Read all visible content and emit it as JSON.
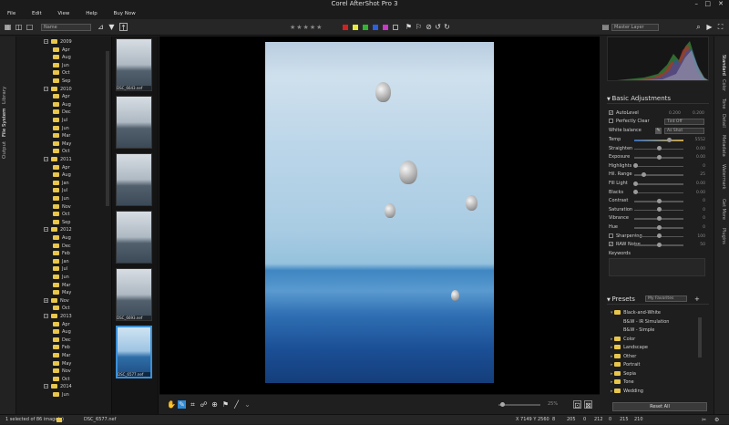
{
  "title": "Corel AfterShot Pro 3",
  "menu": [
    "File",
    "Edit",
    "View",
    "Help",
    "Buy Now"
  ],
  "left_tabs": [
    "Library",
    "File System",
    "Output"
  ],
  "toolbar": {
    "sort_select": "Name",
    "stars": "★★★★★",
    "color_labels": [
      "#d32020",
      "#e8e83a",
      "#2fb52f",
      "#2c5fe0",
      "#c938c9"
    ],
    "layer_select": "Master Layer"
  },
  "tree": [
    {
      "label": "2009",
      "level": 0,
      "expand": "−"
    },
    {
      "label": "Apr",
      "level": 1
    },
    {
      "label": "Aug",
      "level": 1
    },
    {
      "label": "Jun",
      "level": 1
    },
    {
      "label": "Oct",
      "level": 1
    },
    {
      "label": "Sep",
      "level": 1
    },
    {
      "label": "2010",
      "level": 0,
      "expand": "−"
    },
    {
      "label": "Apr",
      "level": 1
    },
    {
      "label": "Aug",
      "level": 1
    },
    {
      "label": "Dec",
      "level": 1
    },
    {
      "label": "Jul",
      "level": 1
    },
    {
      "label": "Jun",
      "level": 1
    },
    {
      "label": "Mar",
      "level": 1
    },
    {
      "label": "May",
      "level": 1
    },
    {
      "label": "Oct",
      "level": 1
    },
    {
      "label": "2011",
      "level": 0,
      "expand": "−"
    },
    {
      "label": "Apr",
      "level": 1
    },
    {
      "label": "Aug",
      "level": 1
    },
    {
      "label": "Jan",
      "level": 1
    },
    {
      "label": "Jul",
      "level": 1
    },
    {
      "label": "Jun",
      "level": 1
    },
    {
      "label": "Nov",
      "level": 1
    },
    {
      "label": "Oct",
      "level": 1
    },
    {
      "label": "Sep",
      "level": 1
    },
    {
      "label": "2012",
      "level": 0,
      "expand": "−"
    },
    {
      "label": "Aug",
      "level": 1
    },
    {
      "label": "Dec",
      "level": 1
    },
    {
      "label": "Feb",
      "level": 1
    },
    {
      "label": "Jan",
      "level": 1
    },
    {
      "label": "Jul",
      "level": 1
    },
    {
      "label": "Jun",
      "level": 1
    },
    {
      "label": "Mar",
      "level": 1
    },
    {
      "label": "May",
      "level": 1
    },
    {
      "label": "Nov",
      "level": 1,
      "expand": "+"
    },
    {
      "label": "Oct",
      "level": 1
    },
    {
      "label": "2013",
      "level": 0,
      "expand": "−"
    },
    {
      "label": "Apr",
      "level": 1
    },
    {
      "label": "Aug",
      "level": 1
    },
    {
      "label": "Dec",
      "level": 1
    },
    {
      "label": "Feb",
      "level": 1
    },
    {
      "label": "Mar",
      "level": 1
    },
    {
      "label": "May",
      "level": 1
    },
    {
      "label": "Nov",
      "level": 1
    },
    {
      "label": "Oct",
      "level": 1
    },
    {
      "label": "2014",
      "level": 0,
      "expand": "−"
    },
    {
      "label": "Jun",
      "level": 1
    }
  ],
  "filmstrip": [
    {
      "label": "DSC_6643.nef",
      "selected": false
    },
    {
      "label": "",
      "selected": false
    },
    {
      "label": "",
      "selected": false
    },
    {
      "label": "",
      "selected": false
    },
    {
      "label": "DSC_6693.nef",
      "selected": false
    },
    {
      "label": "DSC_6577.nef",
      "selected": true
    }
  ],
  "zoom": "25%",
  "status": {
    "selection": "1 selected of 86 image(s)",
    "filename": "DSC_6577.nef",
    "dims": "X 7149 Y 2560",
    "values": [
      "8",
      "205",
      "0",
      "212",
      "0",
      "215",
      "210"
    ]
  },
  "right_tabs": [
    "Standard",
    "Color",
    "Tone",
    "Detail",
    "Metadata",
    "Watermark",
    "Get More",
    "Plugins"
  ],
  "basic_adjustments": {
    "title": "Basic Adjustments",
    "autolevel": {
      "label": "AutoLevel",
      "v1": "0.200",
      "v2": "0.200",
      "checked": true
    },
    "perfectly_clear": {
      "label": "Perfectly Clear",
      "select": "Tint Off",
      "checked": false
    },
    "white_balance": {
      "label": "White balance",
      "select": "As Shot"
    },
    "sliders": [
      {
        "label": "Temp",
        "val": "5552",
        "pos": 0.72,
        "warm": true
      },
      {
        "label": "Straighten",
        "val": "0.00",
        "pos": 0.5
      },
      {
        "label": "Exposure",
        "val": "0.00",
        "pos": 0.5
      },
      {
        "label": "Highlights",
        "val": "0",
        "pos": 0.02
      },
      {
        "label": "Hil. Range",
        "val": "25",
        "pos": 0.2
      },
      {
        "label": "Fill Light",
        "val": "0.00",
        "pos": 0.02
      },
      {
        "label": "Blacks",
        "val": "0.00",
        "pos": 0.02
      },
      {
        "label": "Contrast",
        "val": "0",
        "pos": 0.5
      },
      {
        "label": "Saturation",
        "val": "0",
        "pos": 0.5
      },
      {
        "label": "Vibrance",
        "val": "0",
        "pos": 0.5
      },
      {
        "label": "Hue",
        "val": "0",
        "pos": 0.5
      },
      {
        "label": "Sharpening",
        "val": "100",
        "pos": 0.5,
        "check": false
      },
      {
        "label": "RAW Noise",
        "val": "50",
        "pos": 0.5,
        "check": true
      }
    ],
    "keywords_label": "Keywords"
  },
  "presets": {
    "title": "Presets",
    "select": "My Favorites",
    "items": [
      {
        "label": "Black-and-White",
        "level": 0,
        "open": true
      },
      {
        "label": "B&W - IR Simulation",
        "level": 1
      },
      {
        "label": "B&W - Simple",
        "level": 1
      },
      {
        "label": "Color",
        "level": 0
      },
      {
        "label": "Landscape",
        "level": 0
      },
      {
        "label": "Other",
        "level": 0
      },
      {
        "label": "Portrait",
        "level": 0
      },
      {
        "label": "Sepia",
        "level": 0
      },
      {
        "label": "Tone",
        "level": 0
      },
      {
        "label": "Wedding",
        "level": 0
      }
    ],
    "reset_label": "Reset All"
  }
}
